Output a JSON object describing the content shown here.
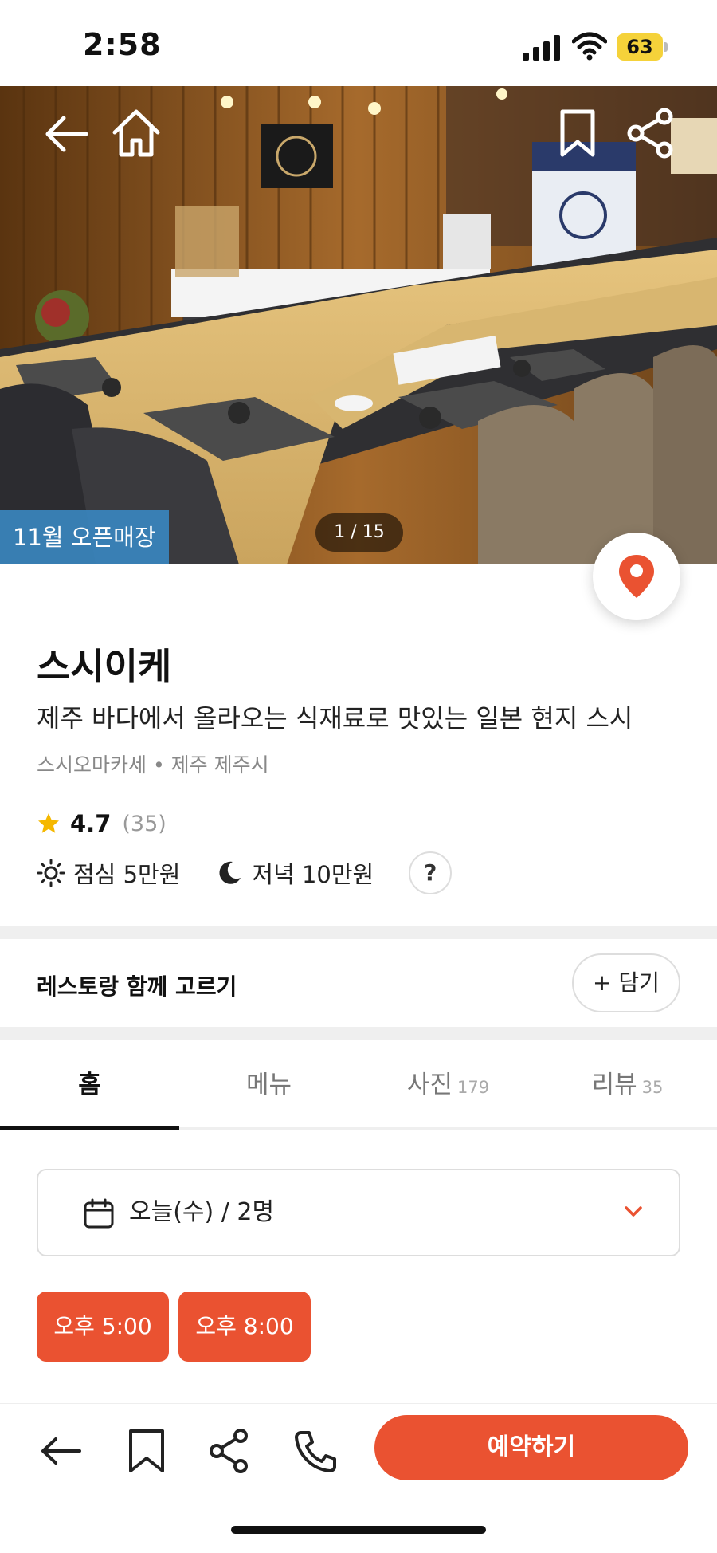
{
  "status_bar": {
    "time": "2:58",
    "battery": "63"
  },
  "hero": {
    "badge": "11월 오픈매장",
    "photo_counter": "1 / 15"
  },
  "restaurant": {
    "name": "스시이케",
    "description": "제주 바다에서 올라오는 식재료로 맛있는 일본 현지 스시",
    "category_location": "스시오마카세 • 제주 제주시",
    "rating": "4.7",
    "review_count": "(35)",
    "lunch_price": "점심 5만원",
    "dinner_price": "저녁 10만원",
    "help_label": "?"
  },
  "compare": {
    "label": "레스토랑 함께 고르기",
    "button": "+ 담기"
  },
  "tabs": [
    {
      "label": "홈",
      "count": ""
    },
    {
      "label": "메뉴",
      "count": ""
    },
    {
      "label": "사진",
      "count": "179"
    },
    {
      "label": "리뷰",
      "count": "35"
    }
  ],
  "date_selector": {
    "value": "오늘(수) / 2명"
  },
  "time_slots": [
    "오후 5:00",
    "오후 8:00"
  ],
  "bottom_bar": {
    "reserve": "예약하기"
  },
  "colors": {
    "accent": "#ea5231",
    "badge": "#3a86be"
  },
  "icons": [
    "back-arrow-icon",
    "home-icon",
    "bookmark-icon",
    "share-icon",
    "map-pin-icon",
    "star-icon",
    "sun-icon",
    "moon-icon",
    "calendar-icon",
    "chevron-down-icon",
    "phone-icon"
  ]
}
